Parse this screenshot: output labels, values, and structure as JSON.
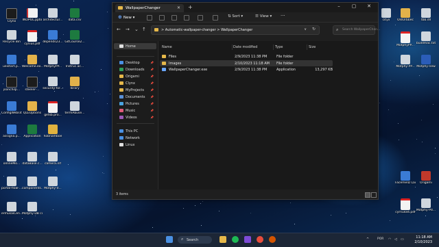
{
  "desktop": {
    "icons": [
      {
        "label": "Clynx",
        "type": "black"
      },
      {
        "label": "INOPOL.pptx",
        "type": "doc"
      },
      {
        "label": "architectur...",
        "type": "gray"
      },
      {
        "label": "data.csv",
        "type": "xls"
      },
      {
        "label": "Recycle Bin",
        "type": "gray"
      },
      {
        "label": "cynius.pdf",
        "type": "pdf"
      },
      {
        "label": "depends23...",
        "type": "app"
      },
      {
        "label": "GitCourse2...",
        "type": "xls"
      },
      {
        "label": "ueistart.p...",
        "type": "app"
      },
      {
        "label": "Welcome.ex...",
        "type": "fold"
      },
      {
        "label": "MotphyPP...",
        "type": "gray"
      },
      {
        "label": "Instruc.ac...",
        "type": "gray"
      },
      {
        "label": "jsonchilp...",
        "type": "black"
      },
      {
        "label": "steeler-...",
        "type": "black"
      },
      {
        "label": "security-for...",
        "type": "gray"
      },
      {
        "label": "lbrary",
        "type": "fold"
      },
      {
        "label": "ConfigWebsit...",
        "type": "app"
      },
      {
        "label": "QLEOptions",
        "type": "fold"
      },
      {
        "label": "getsb.pro...",
        "type": "pdf"
      },
      {
        "label": "termAbuse...",
        "type": "gray"
      },
      {
        "label": "assigna.p...",
        "type": "app"
      },
      {
        "label": "Application",
        "type": "xls"
      },
      {
        "label": "hobnamboe",
        "type": "zip"
      },
      {
        "label": "onlineMo...",
        "type": "gray"
      },
      {
        "label": "dataBase.c...",
        "type": "gray"
      },
      {
        "label": "camera.inf",
        "type": "gray"
      },
      {
        "label": "portal-flow-...",
        "type": "gray"
      },
      {
        "label": "components...",
        "type": "gray"
      },
      {
        "label": "Motphy-d...",
        "type": "gray"
      },
      {
        "label": "ermusaiCen...",
        "type": "gray"
      },
      {
        "label": "Motphy-DB connection...",
        "type": "gray"
      },
      {
        "label": "cityx",
        "type": "gray"
      },
      {
        "label": "OldOrbbec",
        "type": "fold"
      },
      {
        "label": "tbb.dll",
        "type": "gray"
      },
      {
        "label": "MotphyPP...",
        "type": "pdf"
      },
      {
        "label": "buildmac.txt",
        "type": "gray"
      },
      {
        "label": "Motphy-PP...",
        "type": "gray"
      },
      {
        "label": "Motphy-new",
        "type": "wrd"
      },
      {
        "label": "FacemeID Launcher",
        "type": "app"
      },
      {
        "label": "Origami",
        "type": "red"
      },
      {
        "label": "cyrnulol4.pdf",
        "type": "pdf"
      },
      {
        "label": "Motphy-Pd...",
        "type": "gray"
      },
      {
        "label": "MyProject",
        "type": "gray"
      }
    ]
  },
  "window": {
    "tab_title": "WallpaperChanger",
    "toolbar": {
      "new_label": "New",
      "sort_label": "Sort",
      "view_label": "View",
      "more_label": "···"
    },
    "breadcrumb": {
      "part1": "Automatic-wallpaper-changer",
      "sep": ">",
      "part2": "WallpaperChanger"
    },
    "search_placeholder": "Search WallpaperChan...",
    "nav_items": [
      {
        "label": "Home",
        "color": "#e0e0e0",
        "selected": true,
        "pinned": false
      },
      {
        "label": "Desktop",
        "color": "#4a90e2",
        "pinned": true
      },
      {
        "label": "Downloads",
        "color": "#2e9e5a",
        "pinned": true
      },
      {
        "label": "Origami",
        "color": "#e6b84a",
        "pinned": true
      },
      {
        "label": "Clynx",
        "color": "#e6b84a",
        "pinned": true
      },
      {
        "label": "MyProjects",
        "color": "#e6b84a",
        "pinned": true
      },
      {
        "label": "Documents",
        "color": "#5a8fd6",
        "pinned": true
      },
      {
        "label": "Pictures",
        "color": "#4aa3df",
        "pinned": true
      },
      {
        "label": "Music",
        "color": "#e05a7a",
        "pinned": true
      },
      {
        "label": "Videos",
        "color": "#9b59b6",
        "pinned": true
      },
      {
        "label": "This PC",
        "color": "#4a90e2",
        "pinned": false
      },
      {
        "label": "Network",
        "color": "#4a90e2",
        "pinned": false
      },
      {
        "label": "Linux",
        "color": "#e0e0e0",
        "pinned": false
      }
    ],
    "columns": [
      "Name",
      "Date modified",
      "Type",
      "Size"
    ],
    "rows": [
      {
        "name": "Files",
        "date": "2/9/2023 11:38 PM",
        "type": "File folder",
        "size": "",
        "icon": "folder"
      },
      {
        "name": "Images",
        "date": "2/10/2023 11:18 AM",
        "type": "File folder",
        "size": "",
        "icon": "folder"
      },
      {
        "name": "WallpaperChanger.exe",
        "date": "2/9/2023 11:38 PM",
        "type": "Application",
        "size": "13,297 KB",
        "icon": "app"
      }
    ],
    "status": "3 items"
  },
  "taskbar": {
    "search_label": "Search",
    "lang": "POR",
    "time": "11:18 AM",
    "date": "2/10/2023"
  }
}
